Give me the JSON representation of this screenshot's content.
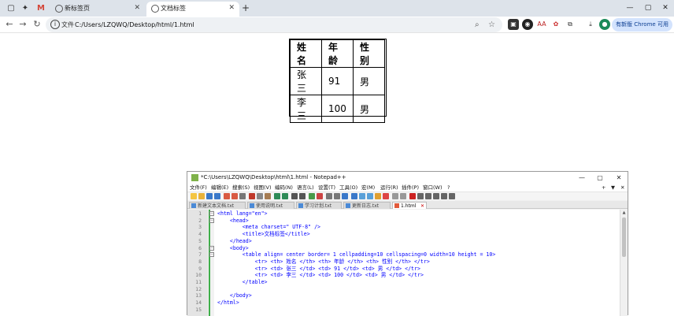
{
  "browser": {
    "tabs": [
      {
        "label": "新标签页",
        "close": "✕"
      },
      {
        "label": "文档标签",
        "close": "✕"
      }
    ],
    "new_tab": "+",
    "window_controls": {
      "minimize": "—",
      "maximize": "▢",
      "close": "✕"
    },
    "address": {
      "file_label": "文件",
      "url": "C:/Users/LZQWQ/Desktop/html/1.html"
    },
    "update_button": "有新版 Chrome 可用"
  },
  "page": {
    "table": {
      "headers": [
        "姓名",
        "年龄",
        "性别"
      ],
      "rows": [
        [
          "张三",
          "91",
          "男"
        ],
        [
          "李三",
          "100",
          "男"
        ]
      ]
    }
  },
  "notepad": {
    "title": "*C:\\Users\\LZQWQ\\Desktop\\html\\1.html - Notepad++",
    "menu": [
      "文件(F)",
      "编辑(E)",
      "搜索(S)",
      "视图(V)",
      "编码(N)",
      "语言(L)",
      "设置(T)",
      "工具(O)",
      "宏(M)",
      "运行(R)",
      "插件(P)",
      "窗口(W)",
      "?"
    ],
    "menu_right": [
      "+",
      "▼",
      "✕"
    ],
    "file_tabs": [
      {
        "label": "新建文本文档.txt"
      },
      {
        "label": "使用说明.txt"
      },
      {
        "label": "学习计划.txt"
      },
      {
        "label": "更新日志.txt"
      },
      {
        "label": "1.html"
      }
    ],
    "line_numbers": [
      "1",
      "2",
      "3",
      "4",
      "5",
      "6",
      "7",
      "8",
      "9",
      "10",
      "11",
      "12",
      "13",
      "14",
      "15"
    ],
    "code_lines": [
      "<html lang=\"en\">",
      "    <head>",
      "        <meta charset=\" UTF-8\" />",
      "        <title>文档标签</title>",
      "    </head>",
      "    <body>",
      "        <table align= center border= 1 cellpadding=10 cellspacing=0 width=10 height = 10>",
      "            <tr> <th> 姓名 </th> <th> 年龄 </th> <th> 性别 </th> </tr>",
      "            <tr> <td> 张三 </td> <td> 91 </td> <td> 男 </td> </tr>",
      "            <tr> <td> 李三 </td> <td> 100 </td> <td> 男 </td> </tr>",
      "        </table>",
      "",
      "    </body>",
      "</html>",
      ""
    ]
  }
}
